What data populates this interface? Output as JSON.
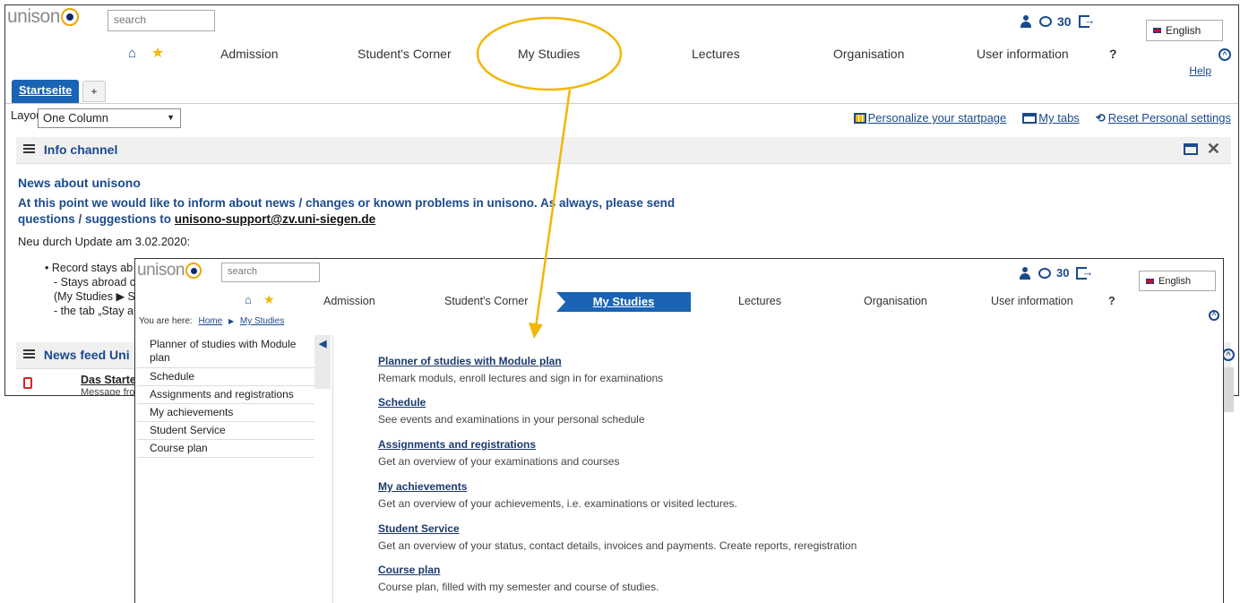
{
  "brand": "unison",
  "search_placeholder": "search",
  "top": {
    "message_count": "30",
    "language": "English"
  },
  "nav": [
    "Admission",
    "Student's Corner",
    "My Studies",
    "Lectures",
    "Organisation",
    "User information",
    "?"
  ],
  "back": {
    "help": "Help",
    "tab_active": "Startseite",
    "tab_add": "+",
    "layout_label": "Layout",
    "layout_value": "One Column",
    "tools": [
      "Personalize your startpage",
      "My tabs",
      "Reset Personal settings"
    ],
    "info_channel_title": "Info channel",
    "news_title": "News about unisono",
    "news_text": "At this point we would like to inform about news / changes or known problems in unisono. As always, please send questions / suggestions to ",
    "news_mail": "unisono-support@zv.uni-siegen.de",
    "update_line": "Neu durch Update am 3.02.2020:",
    "bullets": [
      "Record stays ab",
      "- Stays abroad c",
      "(My Studies ▶ S",
      "- the tab „Stay a"
    ],
    "newsfeed_title": "News feed Uni",
    "newsfeed_item": "Das Starte",
    "newsfeed_sub": "Message fror"
  },
  "front": {
    "breadcrumb_prefix": "You are here:",
    "breadcrumb": [
      "Home",
      "My Studies"
    ],
    "sidebar": [
      "Planner of studies with Module plan",
      "Schedule",
      "Assignments and registrations",
      "My achievements",
      "Student Service",
      "Course plan"
    ],
    "entries": [
      {
        "title": "Planner of studies with Module plan",
        "desc": "Remark moduls, enroll lectures and sign in for examinations"
      },
      {
        "title": "Schedule",
        "desc": "See events and examinations in your personal schedule"
      },
      {
        "title": "Assignments and registrations",
        "desc": "Get an overview of your examinations and courses"
      },
      {
        "title": "My achievements",
        "desc": "Get an overview of your achievements, i.e. examinations or visited lectures."
      },
      {
        "title": "Student Service",
        "desc": "Get an overview of your status, contact details, invoices and payments. Create reports, reregistration"
      },
      {
        "title": "Course plan",
        "desc": "Course plan, filled with my semester and course of studies."
      }
    ]
  },
  "colors": {
    "brand_blue": "#1b4a8c",
    "active_blue": "#1b63b4",
    "highlight": "#f2b705",
    "logo_orange": "#f0a400"
  }
}
